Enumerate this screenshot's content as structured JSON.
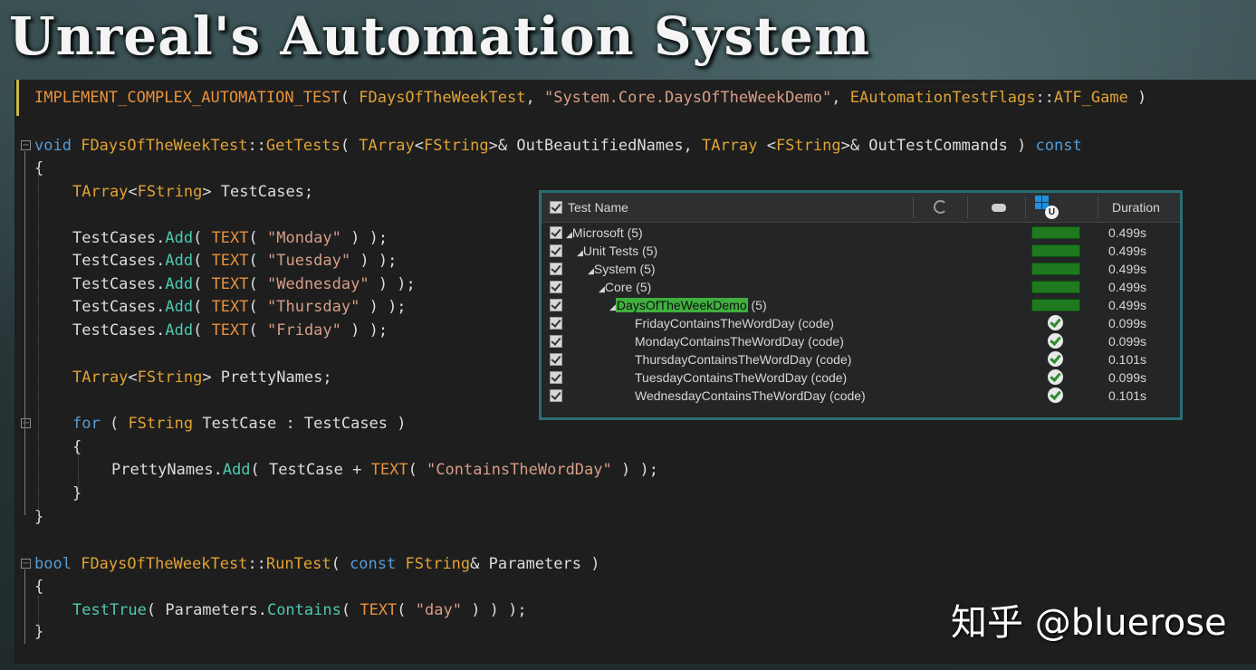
{
  "slide": {
    "title": "Unreal's Automation System",
    "watermark": "知乎 @bluerose"
  },
  "code_lines": [
    {
      "tokens": [
        {
          "c": "m",
          "t": "IMPLEMENT_COMPLEX_AUTOMATION_TEST"
        },
        {
          "c": "p",
          "t": "( "
        },
        {
          "c": "t",
          "t": "FDaysOfTheWeekTest"
        },
        {
          "c": "p",
          "t": ", "
        },
        {
          "c": "s",
          "t": "\"System.Core.DaysOfTheWeekDemo\""
        },
        {
          "c": "p",
          "t": ", "
        },
        {
          "c": "t",
          "t": "EAutomationTestFlags"
        },
        {
          "c": "p",
          "t": "::"
        },
        {
          "c": "t",
          "t": "ATF_Game"
        },
        {
          "c": "p",
          "t": " )"
        }
      ]
    },
    {
      "tokens": [
        {
          "c": "k",
          "t": "void"
        },
        {
          "c": "p",
          "t": " "
        },
        {
          "c": "t",
          "t": "FDaysOfTheWeekTest"
        },
        {
          "c": "p",
          "t": "::"
        },
        {
          "c": "t",
          "t": "GetTests"
        },
        {
          "c": "p",
          "t": "( "
        },
        {
          "c": "t",
          "t": "TArray"
        },
        {
          "c": "p",
          "t": "<"
        },
        {
          "c": "t",
          "t": "FString"
        },
        {
          "c": "p",
          "t": ">& OutBeautifiedNames, "
        },
        {
          "c": "t",
          "t": "TArray"
        },
        {
          "c": "p",
          "t": " <"
        },
        {
          "c": "t",
          "t": "FString"
        },
        {
          "c": "p",
          "t": ">& OutTestCommands ) "
        },
        {
          "c": "k",
          "t": "const"
        }
      ]
    },
    {
      "tokens": [
        {
          "c": "p",
          "t": "{"
        }
      ]
    },
    {
      "tokens": [
        {
          "c": "t",
          "t": "TArray"
        },
        {
          "c": "p",
          "t": "<"
        },
        {
          "c": "t",
          "t": "FString"
        },
        {
          "c": "p",
          "t": "> TestCases;"
        }
      ]
    },
    {
      "tokens": [
        {
          "c": "p",
          "t": "TestCases."
        },
        {
          "c": "f",
          "t": "Add"
        },
        {
          "c": "p",
          "t": "( "
        },
        {
          "c": "m",
          "t": "TEXT"
        },
        {
          "c": "p",
          "t": "( "
        },
        {
          "c": "s",
          "t": "\"Monday\""
        },
        {
          "c": "p",
          "t": " ) );"
        }
      ]
    },
    {
      "tokens": [
        {
          "c": "p",
          "t": "TestCases."
        },
        {
          "c": "f",
          "t": "Add"
        },
        {
          "c": "p",
          "t": "( "
        },
        {
          "c": "m",
          "t": "TEXT"
        },
        {
          "c": "p",
          "t": "( "
        },
        {
          "c": "s",
          "t": "\"Tuesday\""
        },
        {
          "c": "p",
          "t": " ) );"
        }
      ]
    },
    {
      "tokens": [
        {
          "c": "p",
          "t": "TestCases."
        },
        {
          "c": "f",
          "t": "Add"
        },
        {
          "c": "p",
          "t": "( "
        },
        {
          "c": "m",
          "t": "TEXT"
        },
        {
          "c": "p",
          "t": "( "
        },
        {
          "c": "s",
          "t": "\"Wednesday\""
        },
        {
          "c": "p",
          "t": " ) );"
        }
      ]
    },
    {
      "tokens": [
        {
          "c": "p",
          "t": "TestCases."
        },
        {
          "c": "f",
          "t": "Add"
        },
        {
          "c": "p",
          "t": "( "
        },
        {
          "c": "m",
          "t": "TEXT"
        },
        {
          "c": "p",
          "t": "( "
        },
        {
          "c": "s",
          "t": "\"Thursday\""
        },
        {
          "c": "p",
          "t": " ) );"
        }
      ]
    },
    {
      "tokens": [
        {
          "c": "p",
          "t": "TestCases."
        },
        {
          "c": "f",
          "t": "Add"
        },
        {
          "c": "p",
          "t": "( "
        },
        {
          "c": "m",
          "t": "TEXT"
        },
        {
          "c": "p",
          "t": "( "
        },
        {
          "c": "s",
          "t": "\"Friday\""
        },
        {
          "c": "p",
          "t": " ) );"
        }
      ]
    },
    {
      "tokens": [
        {
          "c": "t",
          "t": "TArray"
        },
        {
          "c": "p",
          "t": "<"
        },
        {
          "c": "t",
          "t": "FString"
        },
        {
          "c": "p",
          "t": "> PrettyNames;"
        }
      ]
    },
    {
      "tokens": [
        {
          "c": "k",
          "t": "for"
        },
        {
          "c": "p",
          "t": " ( "
        },
        {
          "c": "t",
          "t": "FString"
        },
        {
          "c": "p",
          "t": " TestCase : TestCases )"
        }
      ]
    },
    {
      "tokens": [
        {
          "c": "p",
          "t": "{"
        }
      ]
    },
    {
      "tokens": [
        {
          "c": "p",
          "t": "PrettyNames."
        },
        {
          "c": "f",
          "t": "Add"
        },
        {
          "c": "p",
          "t": "( TestCase + "
        },
        {
          "c": "m",
          "t": "TEXT"
        },
        {
          "c": "p",
          "t": "( "
        },
        {
          "c": "s",
          "t": "\"ContainsTheWordDay\""
        },
        {
          "c": "p",
          "t": " ) );"
        }
      ]
    },
    {
      "tokens": [
        {
          "c": "p",
          "t": "}"
        }
      ]
    },
    {
      "tokens": [
        {
          "c": "p",
          "t": "}"
        }
      ]
    },
    {
      "tokens": [
        {
          "c": "k",
          "t": "bool"
        },
        {
          "c": "p",
          "t": " "
        },
        {
          "c": "t",
          "t": "FDaysOfTheWeekTest"
        },
        {
          "c": "p",
          "t": "::"
        },
        {
          "c": "t",
          "t": "RunTest"
        },
        {
          "c": "p",
          "t": "( "
        },
        {
          "c": "k",
          "t": "const"
        },
        {
          "c": "p",
          "t": " "
        },
        {
          "c": "t",
          "t": "FString"
        },
        {
          "c": "p",
          "t": "& Parameters )"
        }
      ]
    },
    {
      "tokens": [
        {
          "c": "p",
          "t": "{"
        }
      ]
    },
    {
      "tokens": [
        {
          "c": "f",
          "t": "TestTrue"
        },
        {
          "c": "p",
          "t": "( Parameters."
        },
        {
          "c": "f",
          "t": "Contains"
        },
        {
          "c": "p",
          "t": "( "
        },
        {
          "c": "m",
          "t": "TEXT"
        },
        {
          "c": "p",
          "t": "( "
        },
        {
          "c": "s",
          "t": "\"day\""
        },
        {
          "c": "p",
          "t": " ) ) );"
        }
      ]
    },
    {
      "tokens": [
        {
          "c": "p",
          "t": "}"
        }
      ]
    }
  ],
  "test_window": {
    "header": {
      "test_name": "Test Name",
      "duration": "Duration",
      "col_icons": [
        "spinner-icon",
        "gamepad-icon",
        "windows-unreal-icon"
      ]
    },
    "rows": [
      {
        "label": "Microsoft (5)",
        "expander": "◢",
        "duration": "0.499s",
        "status": "bar"
      },
      {
        "label": "Unit Tests (5)",
        "expander": "◢",
        "duration": "0.499s",
        "status": "bar"
      },
      {
        "label": "System (5)",
        "expander": "◢",
        "duration": "0.499s",
        "status": "bar"
      },
      {
        "label": "Core (5)",
        "expander": "◢",
        "duration": "0.499s",
        "status": "bar"
      },
      {
        "label": "DaysOfTheWeekDemo",
        "suffix": " (5)",
        "expander": "◢",
        "duration": "0.499s",
        "status": "bar",
        "highlight": true
      },
      {
        "label": "FridayContainsTheWordDay (code)",
        "duration": "0.099s",
        "status": "ok"
      },
      {
        "label": "MondayContainsTheWordDay (code)",
        "duration": "0.099s",
        "status": "ok"
      },
      {
        "label": "ThursdayContainsTheWordDay (code)",
        "duration": "0.101s",
        "status": "ok"
      },
      {
        "label": "TuesdayContainsTheWordDay (code)",
        "duration": "0.099s",
        "status": "ok"
      },
      {
        "label": "WednesdayContainsTheWordDay (code)",
        "duration": "0.101s",
        "status": "ok"
      }
    ]
  }
}
